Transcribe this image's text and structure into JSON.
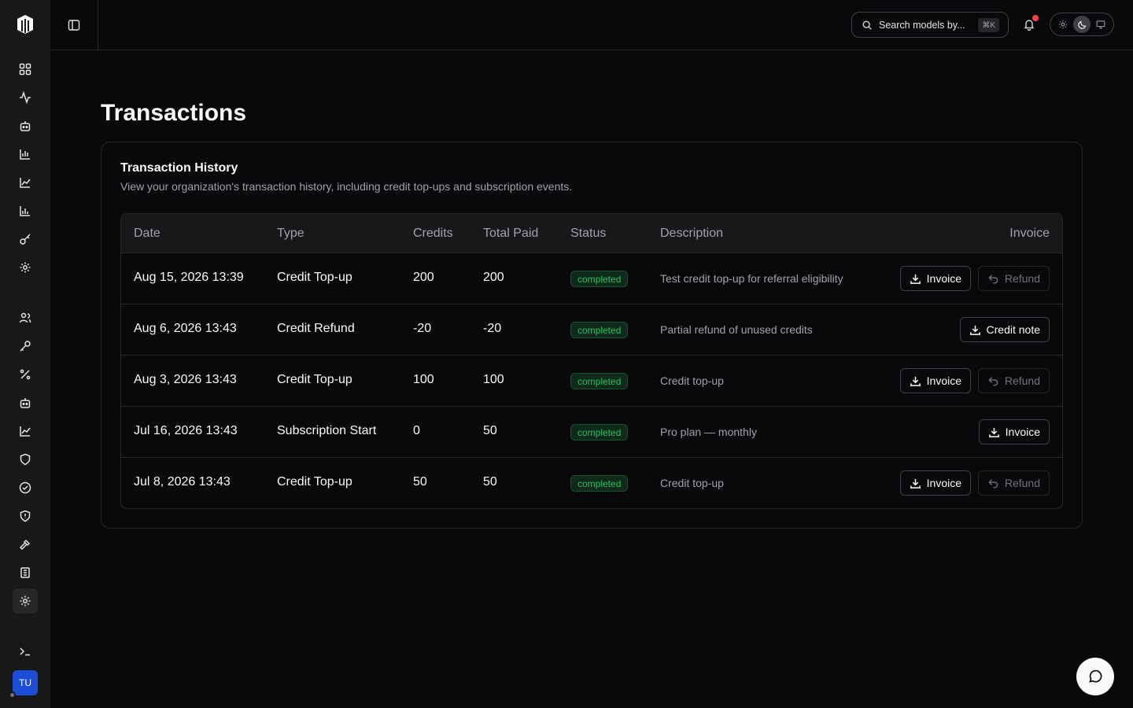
{
  "user": {
    "initials": "TU"
  },
  "search": {
    "placeholder": "Search models by...",
    "shortcut": "⌘K"
  },
  "page": {
    "title": "Transactions"
  },
  "card": {
    "title": "Transaction History",
    "description": "View your organization's transaction history, including credit top-ups and subscription events."
  },
  "table": {
    "headers": {
      "date": "Date",
      "type": "Type",
      "credits": "Credits",
      "total_paid": "Total Paid",
      "status": "Status",
      "description": "Description",
      "invoice": "Invoice"
    },
    "rows": [
      {
        "date": "Aug 15, 2026 13:39",
        "type": "Credit Top-up",
        "credits": "200",
        "total_paid": "200",
        "status": "completed",
        "description": "Test credit top-up for referral eligibility",
        "doc_label": "Invoice",
        "refund_label": "Refund"
      },
      {
        "date": "Aug 6, 2026 13:43",
        "type": "Credit Refund",
        "credits": "-20",
        "total_paid": "-20",
        "status": "completed",
        "description": "Partial refund of unused credits",
        "doc_label": "Credit note",
        "refund_label": null
      },
      {
        "date": "Aug 3, 2026 13:43",
        "type": "Credit Top-up",
        "credits": "100",
        "total_paid": "100",
        "status": "completed",
        "description": "Credit top-up",
        "doc_label": "Invoice",
        "refund_label": "Refund"
      },
      {
        "date": "Jul 16, 2026 13:43",
        "type": "Subscription Start",
        "credits": "0",
        "total_paid": "50",
        "status": "completed",
        "description": "Pro plan — monthly",
        "doc_label": "Invoice",
        "refund_label": null
      },
      {
        "date": "Jul 8, 2026 13:43",
        "type": "Credit Top-up",
        "credits": "50",
        "total_paid": "50",
        "status": "completed",
        "description": "Credit top-up",
        "doc_label": "Invoice",
        "refund_label": "Refund"
      }
    ]
  },
  "colors": {
    "accent": "#1d4ed8",
    "status_green": "#22c55e",
    "notification": "#ef4444"
  }
}
